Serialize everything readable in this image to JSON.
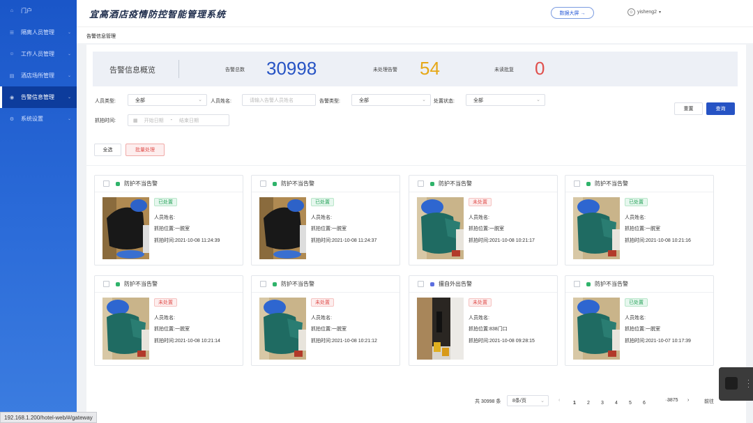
{
  "sidebar": {
    "items": [
      {
        "label": "门户",
        "icon": "home-icon"
      },
      {
        "label": "隔离人员管理",
        "icon": "list-icon"
      },
      {
        "label": "工作人员管理",
        "icon": "user-icon"
      },
      {
        "label": "酒店场所管理",
        "icon": "building-icon"
      },
      {
        "label": "告警信息管理",
        "icon": "alarm-icon"
      },
      {
        "label": "系统设置",
        "icon": "gear-icon"
      }
    ]
  },
  "header": {
    "title": "宜高酒店疫情防控智能管理系统",
    "data_screen_button": "数据大屏 →",
    "username": "yisheng2"
  },
  "breadcrumb": "告警信息管理",
  "overview": {
    "title": "告警信息概览",
    "total_label": "告警总数",
    "total_value": "30998",
    "pending_label": "未处理告警",
    "pending_value": "54",
    "unread_label": "未读批复",
    "unread_value": "0",
    "colors": {
      "total": "#2653c4",
      "pending": "#e6a817",
      "unread": "#e0504d"
    }
  },
  "filters": {
    "person_type_label": "人员类型:",
    "person_type_value": "全部",
    "person_name_label": "人员姓名:",
    "person_name_placeholder": "请输入告警人员姓名",
    "alarm_type_label": "告警类型:",
    "alarm_type_value": "全部",
    "handle_status_label": "处置状态:",
    "handle_status_value": "全部",
    "capture_time_label": "抓拍时间:",
    "start_placeholder": "开始日期",
    "date_separator": "-",
    "end_placeholder": "结束日期",
    "reset_label": "重置",
    "query_label": "查询"
  },
  "actions": {
    "select_all_label": "全选",
    "batch_handle_label": "批量处理"
  },
  "field_labels": {
    "name": "人员姓名:",
    "location": "抓拍位置:",
    "time": "抓拍时间:"
  },
  "cards": [
    {
      "title": "防护不当告警",
      "status": "已处置",
      "status_type": "done",
      "name": "",
      "location": "一脱室",
      "time": "2021-10-08 11:24:39",
      "image": "black"
    },
    {
      "title": "防护不当告警",
      "status": "已处置",
      "status_type": "done",
      "name": "",
      "location": "一脱室",
      "time": "2021-10-08 11:24:37",
      "image": "black"
    },
    {
      "title": "防护不当告警",
      "status": "未处置",
      "status_type": "todo",
      "name": "",
      "location": "一脱室",
      "time": "2021-10-08 10:21:17",
      "image": "green"
    },
    {
      "title": "防护不当告警",
      "status": "已处置",
      "status_type": "done",
      "name": "",
      "location": "一脱室",
      "time": "2021-10-08 10:21:16",
      "image": "green"
    },
    {
      "title": "防护不当告警",
      "status": "未处置",
      "status_type": "todo",
      "name": "",
      "location": "一脱室",
      "time": "2021-10-08 10:21:14",
      "image": "green"
    },
    {
      "title": "防护不当告警",
      "status": "未处置",
      "status_type": "todo",
      "name": "",
      "location": "一脱室",
      "time": "2021-10-08 10:21:12",
      "image": "green"
    },
    {
      "title": "擅自外出告警",
      "status": "未处置",
      "status_type": "todo",
      "name": "",
      "location": "838门口",
      "time": "2021-10-08 09:28:15",
      "image": "door"
    },
    {
      "title": "防护不当告警",
      "status": "已处置",
      "status_type": "done",
      "name": "",
      "location": "一脱室",
      "time": "2021-10-07 10:17:39",
      "image": "green"
    }
  ],
  "pagination": {
    "total_text": "共 30998 条",
    "page_size": "8条/页",
    "pages": [
      "1",
      "2",
      "3",
      "4",
      "5",
      "6"
    ],
    "ellipsis": "···",
    "last_page": "3875",
    "goto_label": "前往",
    "prev_icon": "chevron-left-icon",
    "next_icon": "chevron-right-icon"
  },
  "url_bar": "192.168.1.200/hotel-web/#/gateway"
}
